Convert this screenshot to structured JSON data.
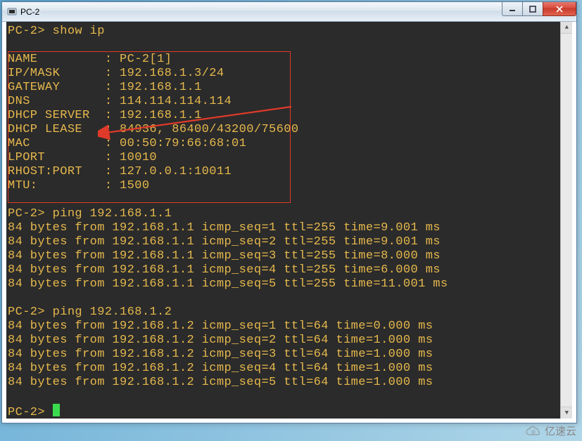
{
  "window": {
    "title": "PC-2"
  },
  "prompt": "PC-2>",
  "cmd1": "show ip",
  "info": {
    "headers": [
      "NAME",
      "IP/MASK",
      "GATEWAY",
      "DNS",
      "DHCP SERVER",
      "DHCP LEASE",
      "MAC",
      "LPORT",
      "RHOST:PORT",
      "MTU:"
    ],
    "values": [
      "PC-2[1]",
      "192.168.1.3/24",
      "192.168.1.1",
      "114.114.114.114",
      "192.168.1.1",
      "84936, 86400/43200/75600",
      "00:50:79:66:68:01",
      "10010",
      "127.0.0.1:10011",
      "1500"
    ]
  },
  "cmd2": "ping 192.168.1.1",
  "ping1": [
    "84 bytes from 192.168.1.1 icmp_seq=1 ttl=255 time=9.001 ms",
    "84 bytes from 192.168.1.1 icmp_seq=2 ttl=255 time=9.001 ms",
    "84 bytes from 192.168.1.1 icmp_seq=3 ttl=255 time=8.000 ms",
    "84 bytes from 192.168.1.1 icmp_seq=4 ttl=255 time=6.000 ms",
    "84 bytes from 192.168.1.1 icmp_seq=5 ttl=255 time=11.001 ms"
  ],
  "cmd3": "ping 192.168.1.2",
  "ping2": [
    "84 bytes from 192.168.1.2 icmp_seq=1 ttl=64 time=0.000 ms",
    "84 bytes from 192.168.1.2 icmp_seq=2 ttl=64 time=1.000 ms",
    "84 bytes from 192.168.1.2 icmp_seq=3 ttl=64 time=1.000 ms",
    "84 bytes from 192.168.1.2 icmp_seq=4 ttl=64 time=1.000 ms",
    "84 bytes from 192.168.1.2 icmp_seq=5 ttl=64 time=1.000 ms"
  ],
  "watermark": "亿速云"
}
